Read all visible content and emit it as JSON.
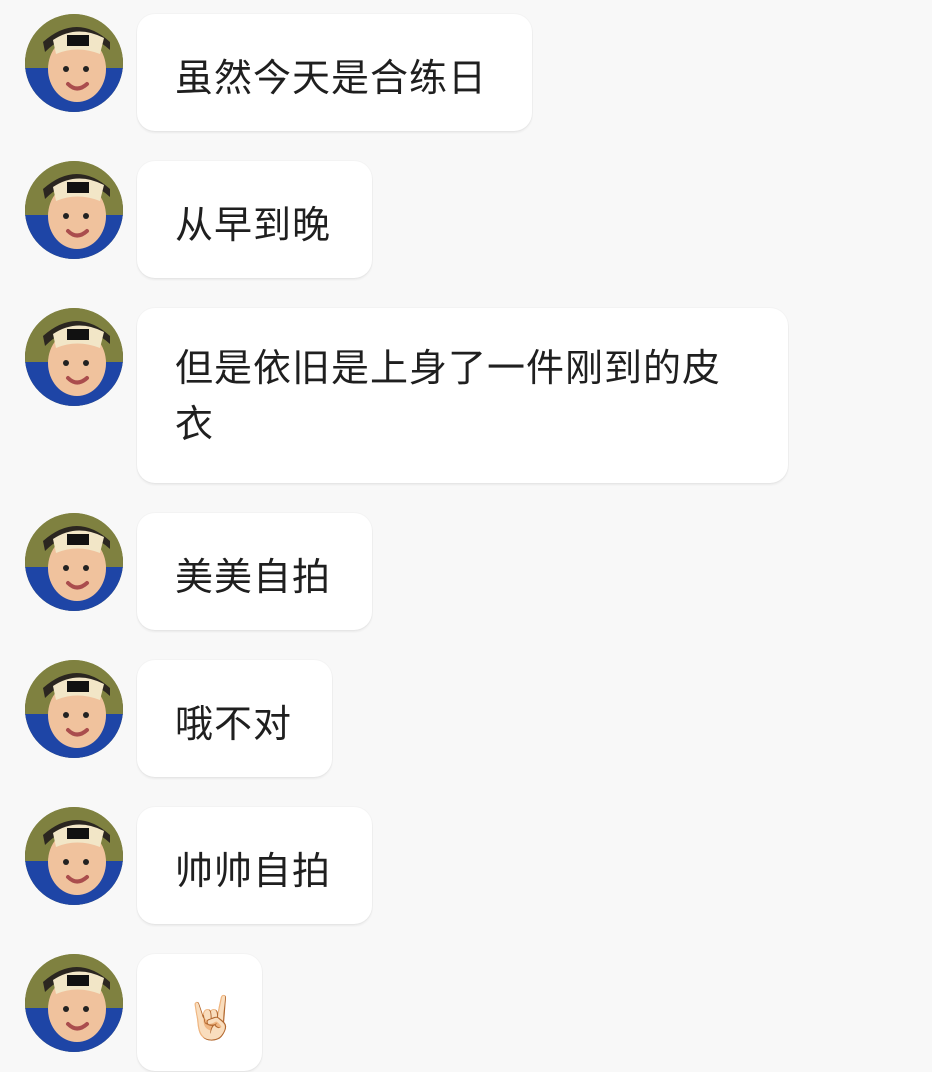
{
  "chat": {
    "messages": [
      {
        "text": "虽然今天是合练日",
        "avatar": "user-avatar"
      },
      {
        "text": "从早到晚",
        "avatar": "user-avatar"
      },
      {
        "text": "但是依旧是上身了一件刚到的皮衣",
        "avatar": "user-avatar"
      },
      {
        "text": "美美自拍",
        "avatar": "user-avatar"
      },
      {
        "text": "哦不对",
        "avatar": "user-avatar"
      },
      {
        "text": "帅帅自拍",
        "avatar": "user-avatar"
      },
      {
        "text": "🤘🏻",
        "avatar": "user-avatar"
      }
    ]
  },
  "colors": {
    "background": "#f8f8f8",
    "bubble": "#ffffff",
    "text": "#1f1f1f"
  }
}
